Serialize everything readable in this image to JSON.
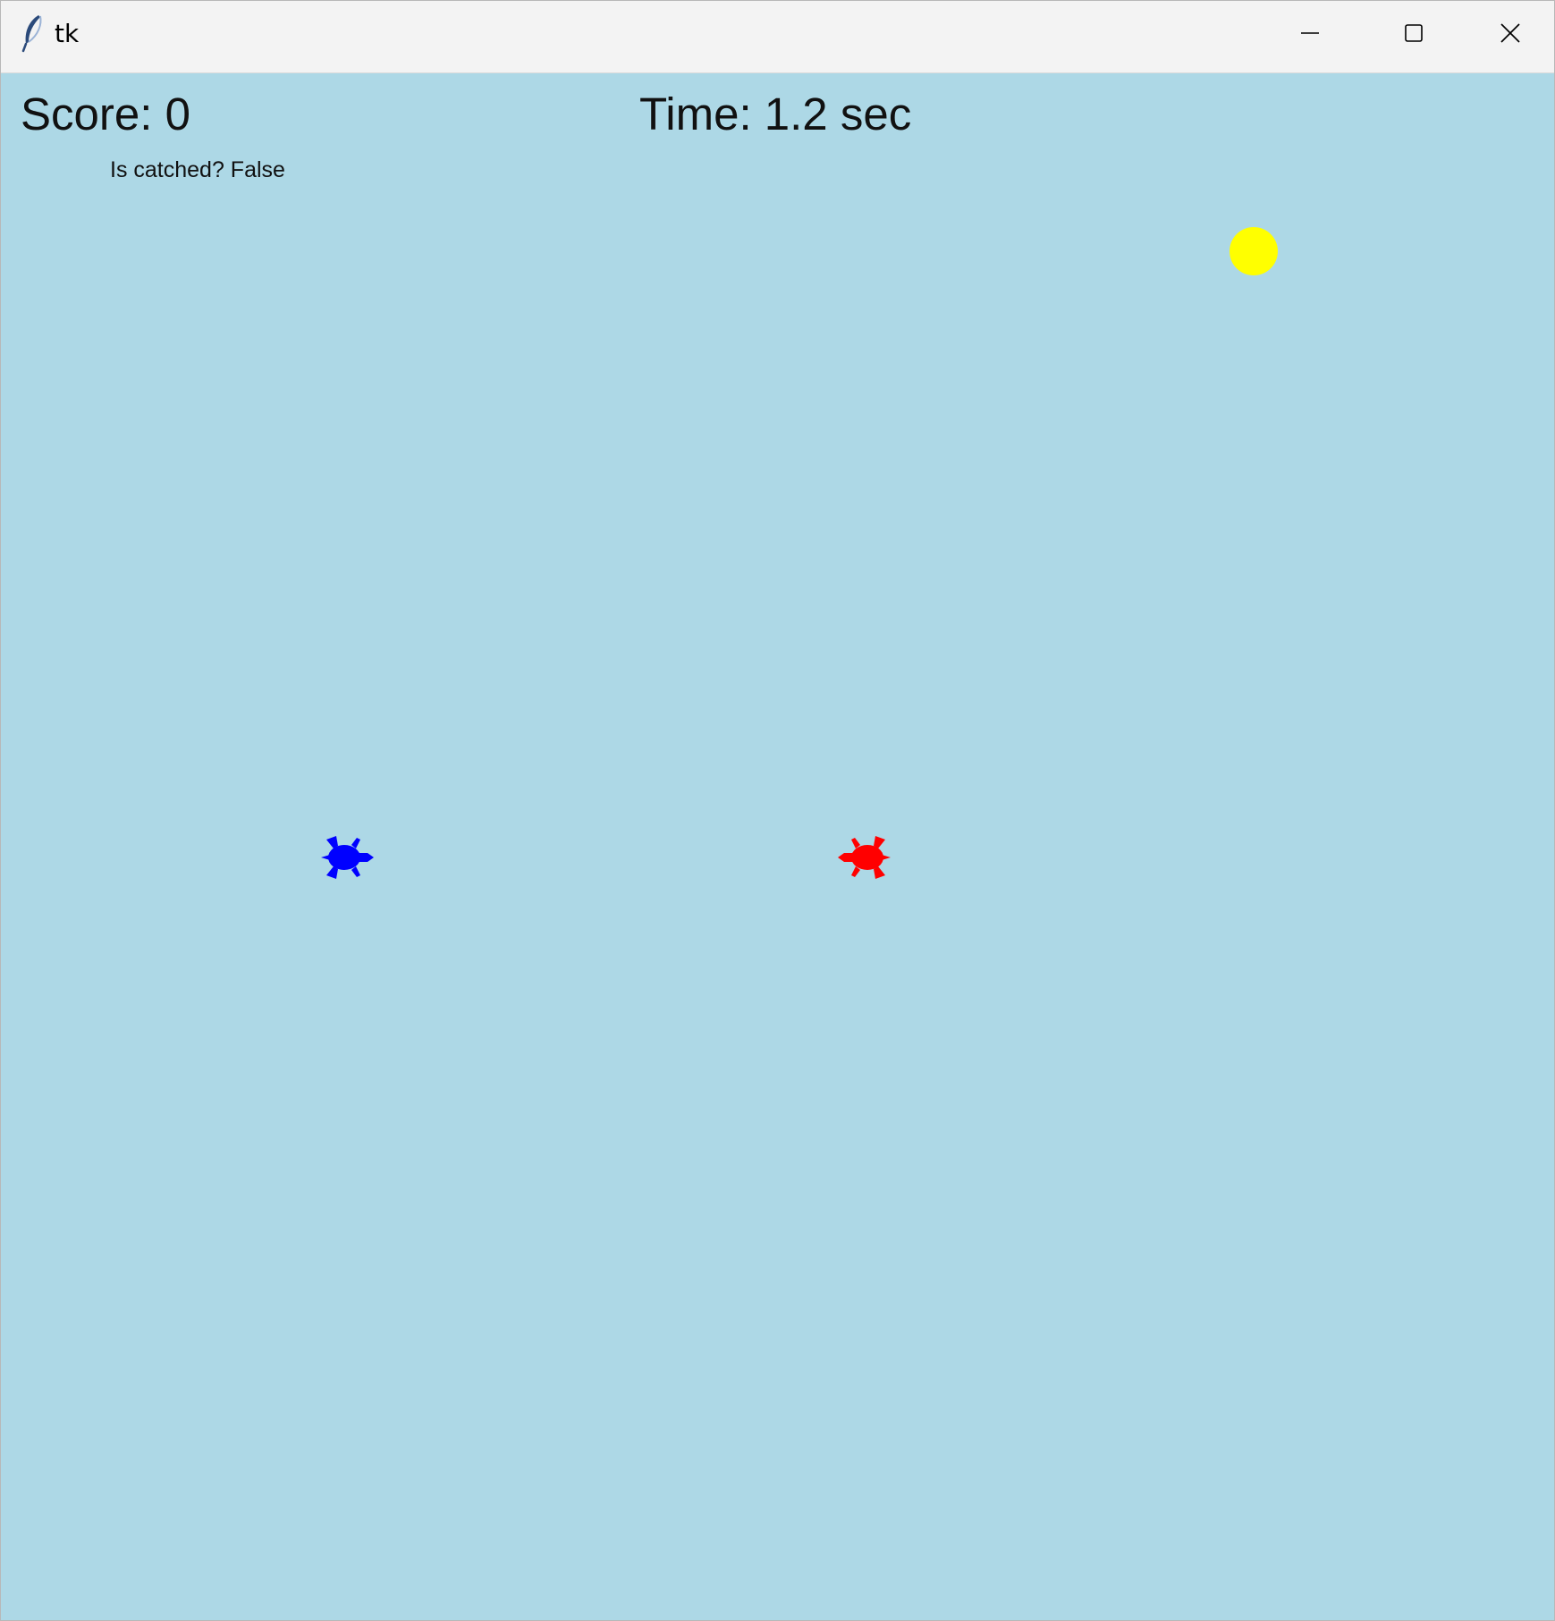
{
  "window": {
    "title": "tk",
    "icon": "feather-icon",
    "controls": [
      "minimize-icon",
      "maximize-icon",
      "close-icon"
    ]
  },
  "hud": {
    "score_text": "Score: 0",
    "time_text": "Time: 1.2 sec",
    "catched_text": "Is catched? False"
  },
  "game": {
    "score": 0,
    "time_sec": 1.2,
    "is_catched": false,
    "colors": {
      "background": "#add8e6",
      "food": "#ffff00",
      "player_turtle": "#0000ff",
      "enemy_turtle": "#ff0000"
    },
    "player_turtle": {
      "icon": "turtle-icon",
      "heading": "east"
    },
    "enemy_turtle": {
      "icon": "turtle-icon",
      "heading": "west"
    },
    "food": {
      "icon": "circle-icon"
    }
  }
}
